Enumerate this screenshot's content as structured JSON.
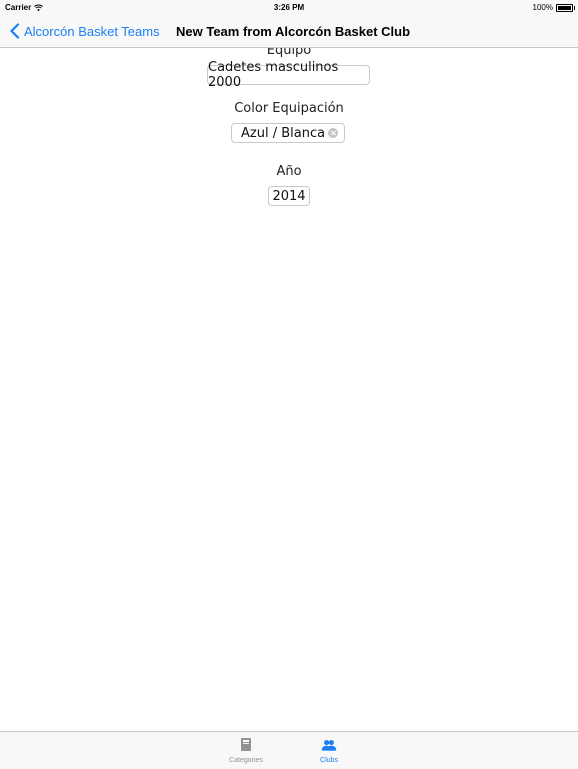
{
  "status_bar": {
    "carrier": "Carrier",
    "time": "3:26 PM",
    "battery": "100%"
  },
  "nav": {
    "back_label": "Alcorcón Basket Teams",
    "title": "New Team from Alcorcón Basket Club"
  },
  "form": {
    "team": {
      "label": "Equipo",
      "value": "Cadetes masculinos 2000"
    },
    "kit_color": {
      "label": "Color Equipación",
      "value": "Azul / Blanca"
    },
    "year": {
      "label": "Año",
      "value": "2014"
    }
  },
  "tab_bar": {
    "tabs": [
      {
        "label": "Categories",
        "icon": "book-icon",
        "active": false
      },
      {
        "label": "Clubs",
        "icon": "people-icon",
        "active": true
      }
    ]
  },
  "colors": {
    "accent": "#1a7ff5",
    "inactive": "#929292",
    "bar": "#f8f8f8"
  }
}
